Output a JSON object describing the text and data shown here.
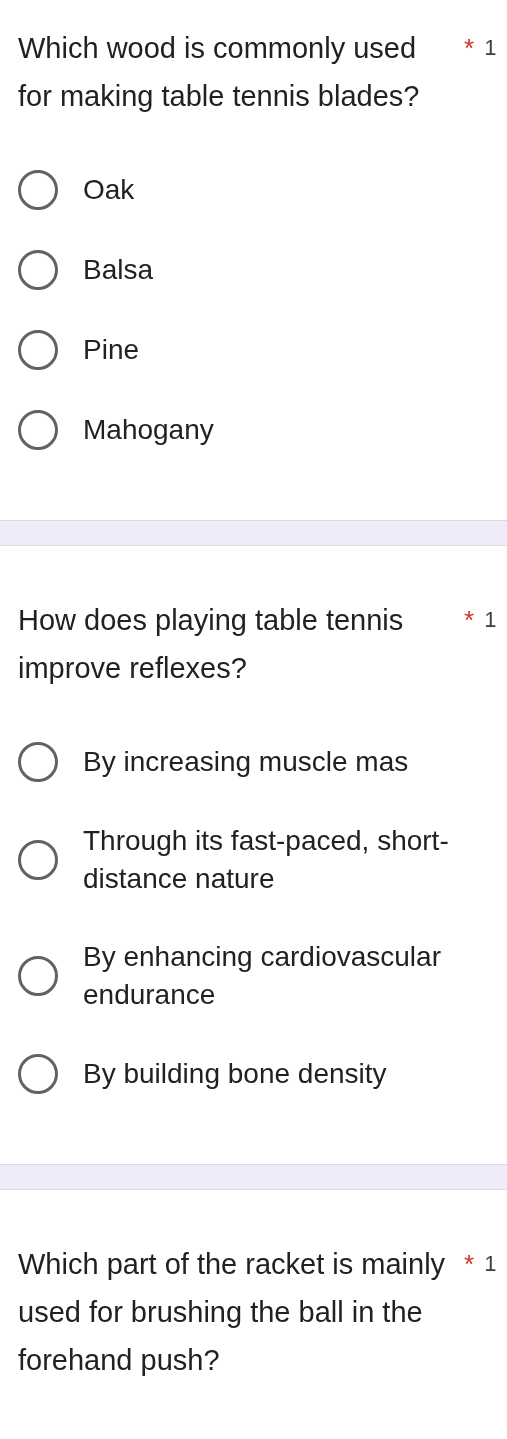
{
  "questions": [
    {
      "title": "Which wood is commonly used for making table tennis blades?",
      "required_mark": "*",
      "points": "1",
      "options": [
        {
          "label": "Oak",
          "selected": false
        },
        {
          "label": "Balsa",
          "selected": false
        },
        {
          "label": "Pine",
          "selected": false
        },
        {
          "label": "Mahogany",
          "selected": false
        }
      ]
    },
    {
      "title": "How does playing table tennis improve reflexes?",
      "required_mark": "*",
      "points": "1",
      "options": [
        {
          "label": "By increasing muscle mas",
          "selected": false
        },
        {
          "label": "Through its fast-paced, short-distance nature",
          "selected": false
        },
        {
          "label": "By enhancing cardiovascular endurance",
          "selected": false
        },
        {
          "label": "By building bone density",
          "selected": false
        }
      ]
    },
    {
      "title": "Which part of the racket is mainly used for brushing the ball in the forehand push?",
      "required_mark": "*",
      "points": "1"
    }
  ]
}
